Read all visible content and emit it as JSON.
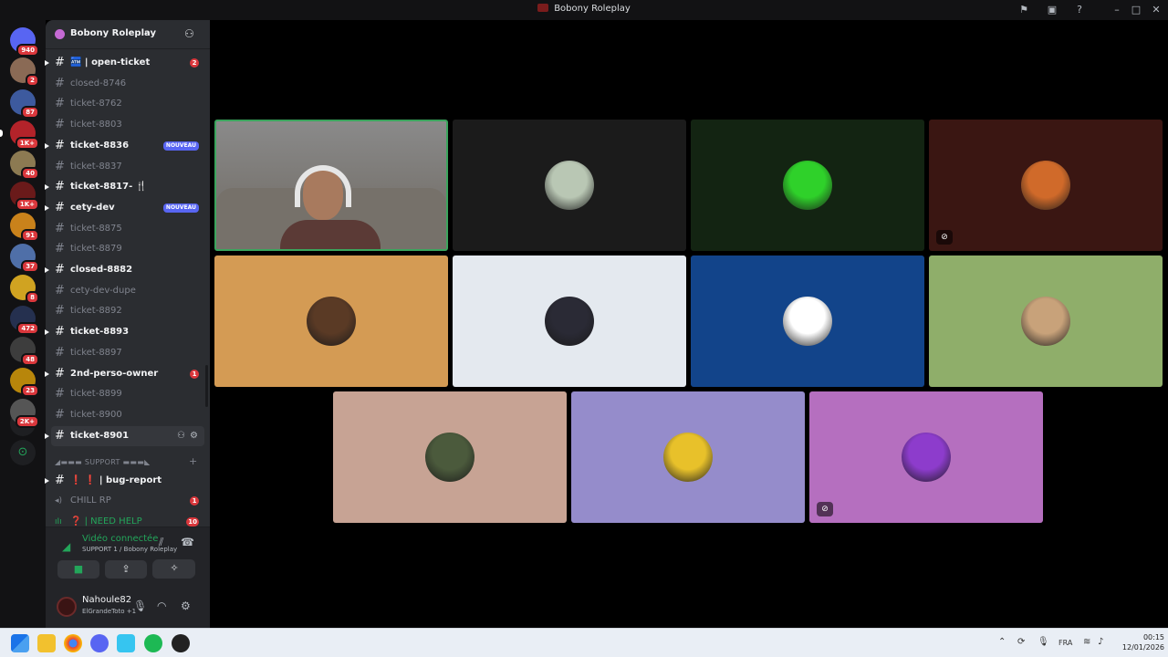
{
  "window": {
    "title": "Bobony Roleplay"
  },
  "server_rail": {
    "items": [
      {
        "name": "Direct Messages",
        "badge": "940",
        "color": "#5865f2"
      },
      {
        "name": "server-1",
        "badge": "2",
        "color": "#8a6a55"
      },
      {
        "name": "server-2",
        "badge": "87",
        "color": "#3d5a9e"
      },
      {
        "name": "server-3",
        "badge": "1K+",
        "color": "#b3232a"
      },
      {
        "name": "server-4",
        "badge": "40",
        "color": "#8c7a52"
      },
      {
        "name": "server-5",
        "badge": "1K+",
        "color": "#6a1a1a"
      },
      {
        "name": "server-6",
        "badge": "91",
        "color": "#c9821b"
      },
      {
        "name": "server-7",
        "badge": "37",
        "color": "#4f6fa8"
      },
      {
        "name": "server-8",
        "badge": "8",
        "color": "#d0a321"
      },
      {
        "name": "server-9",
        "badge": "472",
        "color": "#25304f"
      },
      {
        "name": "server-10",
        "badge": "48",
        "color": "#3d3d3d"
      },
      {
        "name": "server-11",
        "badge": "23",
        "color": "#b8860b"
      },
      {
        "name": "server-12",
        "badge": "2K+",
        "color": "#555555"
      }
    ]
  },
  "guild": {
    "name": "Bobony Roleplay"
  },
  "channels": [
    {
      "name": "🏧 | open-ticket",
      "unread": true,
      "count": "2"
    },
    {
      "name": "closed-8746",
      "unread": false
    },
    {
      "name": "ticket-8762",
      "unread": false
    },
    {
      "name": "ticket-8803",
      "unread": false
    },
    {
      "name": "ticket-8836",
      "unread": true,
      "tag": "NOUVEAU"
    },
    {
      "name": "ticket-8837",
      "unread": false
    },
    {
      "name": "ticket-8817- 🍴",
      "unread": true
    },
    {
      "name": "cety-dev",
      "unread": true,
      "tag": "NOUVEAU"
    },
    {
      "name": "ticket-8875",
      "unread": false
    },
    {
      "name": "ticket-8879",
      "unread": false
    },
    {
      "name": "closed-8882",
      "unread": true
    },
    {
      "name": "cety-dev-dupe",
      "unread": false
    },
    {
      "name": "ticket-8892",
      "unread": false
    },
    {
      "name": "ticket-8893",
      "unread": true
    },
    {
      "name": "ticket-8897",
      "unread": false
    },
    {
      "name": "2nd-perso-owner",
      "unread": true,
      "count": "1"
    },
    {
      "name": "ticket-8899",
      "unread": false
    },
    {
      "name": "ticket-8900",
      "unread": false
    },
    {
      "name": "ticket-8901",
      "unread": true
    }
  ],
  "category": {
    "label": "◢▬▬▬ SUPPORT ▬▬▬◣"
  },
  "support_channels": [
    {
      "name": "❗ ❗ | bug-report",
      "unread": true,
      "kind": "text"
    },
    {
      "name": "CHILL RP",
      "unread": false,
      "kind": "voice",
      "count": "1"
    },
    {
      "name": "❓ | NEED HELP",
      "unread": false,
      "kind": "voice-active",
      "count": "10"
    }
  ],
  "voice_panel": {
    "status": "Vidéo connectée",
    "location": "SUPPORT 1 / Bobony Roleplay"
  },
  "user_panel": {
    "username": "Nahoule82",
    "activity": "ElGrandeToto +1"
  },
  "tiles": [
    {
      "name": "camera-participant",
      "bg": "#6e6e6e",
      "camera": true
    },
    {
      "name": "participant-2",
      "bg": "#1b1b1b",
      "avatar": "#b9c7b4"
    },
    {
      "name": "participant-3",
      "bg": "#132412",
      "avatar": "#2fd12a"
    },
    {
      "name": "participant-4",
      "bg": "#3a1612",
      "avatar": "#d06a2a",
      "muted": true
    },
    {
      "name": "participant-5",
      "bg": "#d49b54",
      "avatar": "#5a3a25"
    },
    {
      "name": "participant-6",
      "bg": "#e4e9ef",
      "avatar": "#2a2a35"
    },
    {
      "name": "participant-7",
      "bg": "#12448a",
      "avatar": "#ffffff"
    },
    {
      "name": "participant-8",
      "bg": "#8fae6a",
      "avatar": "#c8a27a"
    },
    {
      "name": "participant-9",
      "bg": "#c7a394",
      "avatar": "#4b5a3c"
    },
    {
      "name": "participant-10",
      "bg": "#958ccb",
      "avatar": "#e8c12a"
    },
    {
      "name": "participant-11",
      "bg": "#b56fbf",
      "avatar": "#8d3ccc",
      "muted": true
    }
  ],
  "taskbar": {
    "lang": "FRA",
    "time": "00:15",
    "date": "12/01/2026"
  }
}
